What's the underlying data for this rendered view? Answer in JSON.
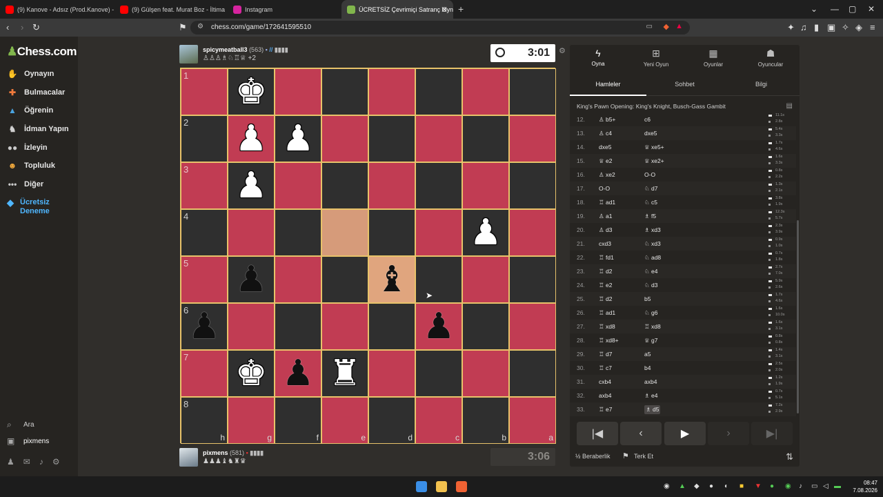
{
  "browser": {
    "tabs": [
      {
        "title": "(9) Kanove - Adsız (Prod.Kanove) - Yo",
        "fav": "#ff0000"
      },
      {
        "title": "(9) Gülşen feat. Murat Boz - İltima",
        "fav": "#ff0000"
      },
      {
        "title": "Instagram",
        "fav": "#d6249f"
      },
      {
        "title": "ÜCRETSİZ Çevrimiçi Satranç Oyna",
        "fav": "#81b64c"
      }
    ],
    "url": "chess.com/game/172641595510"
  },
  "sidebar": {
    "logo": "Chess.com",
    "items": [
      {
        "label": "Oynayın",
        "icon": "play-hand-icon"
      },
      {
        "label": "Bulmacalar",
        "icon": "puzzle-icon"
      },
      {
        "label": "Öğrenin",
        "icon": "learn-cap-icon"
      },
      {
        "label": "İdman Yapın",
        "icon": "train-icon"
      },
      {
        "label": "İzleyin",
        "icon": "watch-binoculars-icon"
      },
      {
        "label": "Topluluk",
        "icon": "community-icon"
      },
      {
        "label": "Diğer",
        "icon": "more-dots-icon"
      }
    ],
    "trial": "Ücretsiz Deneme",
    "search": "Ara",
    "user": "pixmens"
  },
  "top_player": {
    "name": "spicymeatball3",
    "rating": "(563)",
    "captured": "♙♙♙♗♘♖♕",
    "plus": "+2",
    "clock": "3:01"
  },
  "bottom_player": {
    "name": "pixmens",
    "rating": "(581)",
    "captured": "♟♟♟♝♞♜♛",
    "clock": "3:06"
  },
  "board": {
    "ranks": [
      "1",
      "2",
      "3",
      "4",
      "5",
      "6",
      "7",
      "8"
    ],
    "files": [
      "h",
      "g",
      "f",
      "e",
      "d",
      "c",
      "b",
      "a"
    ],
    "pieces": [
      {
        "sq": "g1",
        "p": "♚",
        "c": "w"
      },
      {
        "sq": "g2",
        "p": "♟",
        "c": "w"
      },
      {
        "sq": "f2",
        "p": "♟",
        "c": "w"
      },
      {
        "sq": "g3",
        "p": "♟",
        "c": "w"
      },
      {
        "sq": "b4",
        "p": "♟",
        "c": "w"
      },
      {
        "sq": "g5",
        "p": "♟",
        "c": "b"
      },
      {
        "sq": "d5",
        "p": "♝",
        "c": "b"
      },
      {
        "sq": "h6",
        "p": "♟",
        "c": "b"
      },
      {
        "sq": "c6",
        "p": "♟",
        "c": "b"
      },
      {
        "sq": "g7",
        "p": "♚",
        "c": "w2"
      },
      {
        "sq": "f7",
        "p": "♟",
        "c": "b"
      },
      {
        "sq": "e7",
        "p": "♜",
        "c": "w"
      }
    ]
  },
  "panel": {
    "tabs": [
      {
        "label": "Oyna",
        "icon": "bolt-icon"
      },
      {
        "label": "Yeni Oyun",
        "icon": "plus-icon"
      },
      {
        "label": "Oyunlar",
        "icon": "board-icon"
      },
      {
        "label": "Oyuncular",
        "icon": "players-icon"
      }
    ],
    "subtabs": [
      "Hamleler",
      "Sohbet",
      "Bilgi"
    ],
    "opening": "King's Pawn Opening: King's Knight, Busch-Gass Gambit",
    "moves": [
      {
        "n": "12.",
        "w": "♙ b5+",
        "b": "c6",
        "tw": "11.1s",
        "tb": "2.8s"
      },
      {
        "n": "13.",
        "w": "♙ c4",
        "b": "dxe5",
        "tw": "5.4s",
        "tb": "3.3s"
      },
      {
        "n": "14.",
        "w": "dxe5",
        "b": "♕ xe5+",
        "tw": "1.7s",
        "tb": "4.6s"
      },
      {
        "n": "15.",
        "w": "♕ e2",
        "b": "♕ xe2+",
        "tw": "1.6s",
        "tb": "3.3s"
      },
      {
        "n": "16.",
        "w": "♙ xe2",
        "b": "O-O",
        "tw": "0.8s",
        "tb": "2.2s"
      },
      {
        "n": "17.",
        "w": "O-O",
        "b": "♘ d7",
        "tw": "1.3s",
        "tb": "2.1s"
      },
      {
        "n": "18.",
        "w": "♖ ad1",
        "b": "♘ c5",
        "tw": "3.8s",
        "tb": "1.9s"
      },
      {
        "n": "19.",
        "w": "♙ a1",
        "b": "♗ f5",
        "tw": "12.3s",
        "tb": "5.7s"
      },
      {
        "n": "20.",
        "w": "♙ d3",
        "b": "♗ xd3",
        "tw": "2.3s",
        "tb": "3.9s"
      },
      {
        "n": "21.",
        "w": "cxd3",
        "b": "♘ xd3",
        "tw": "0.9s",
        "tb": "1.0s"
      },
      {
        "n": "22.",
        "w": "♖ fd1",
        "b": "♘ ad8",
        "tw": "0.7s",
        "tb": "1.8s"
      },
      {
        "n": "23.",
        "w": "♖ d2",
        "b": "♘ e4",
        "tw": "2.7s",
        "tb": "7.0s"
      },
      {
        "n": "24.",
        "w": "♖ e2",
        "b": "♘ d3",
        "tw": "5.9s",
        "tb": "2.6s"
      },
      {
        "n": "25.",
        "w": "♖ d2",
        "b": "b5",
        "tw": "1.7s",
        "tb": "4.6s"
      },
      {
        "n": "26.",
        "w": "♖ ad1",
        "b": "♘ g6",
        "tw": "1.6s",
        "tb": "10.0s"
      },
      {
        "n": "27.",
        "w": "♖ xd8",
        "b": "♖ xd8",
        "tw": "1.6s",
        "tb": "3.1s"
      },
      {
        "n": "28.",
        "w": "♖ xd8+",
        "b": "♕ g7",
        "tw": "0.8s",
        "tb": "0.8s"
      },
      {
        "n": "29.",
        "w": "♖ d7",
        "b": "a5",
        "tw": "1.4s",
        "tb": "3.1s"
      },
      {
        "n": "30.",
        "w": "♖ c7",
        "b": "b4",
        "tw": "2.5s",
        "tb": "2.0s"
      },
      {
        "n": "31.",
        "w": "cxb4",
        "b": "axb4",
        "tw": "1.2s",
        "tb": "1.9s"
      },
      {
        "n": "32.",
        "w": "axb4",
        "b": "♗ e4",
        "tw": "0.7s",
        "tb": "5.1s"
      },
      {
        "n": "33.",
        "w": "♖ e7",
        "b": "♗ d5",
        "tw": "7.2s",
        "tb": "2.9s"
      }
    ],
    "draw": "½ Beraberlik",
    "resign": "Terk Et"
  },
  "taskbar": {
    "time": "08:47",
    "date": "7.08.2026"
  }
}
